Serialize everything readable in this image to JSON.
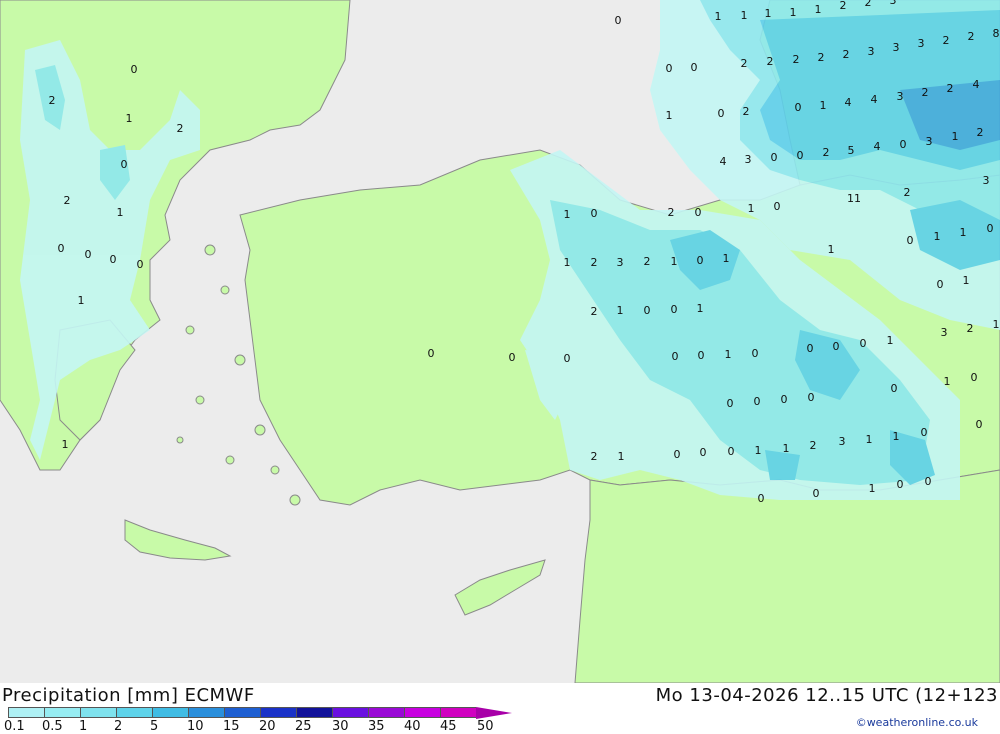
{
  "title": "Precipitation [mm] ECMWF",
  "datetime": "Mo 13-04-2026 12..15 UTC (12+123",
  "credit": "©weatheronline.co.uk",
  "legend": {
    "labels": [
      "0.1",
      "0.5",
      "1",
      "2",
      "5",
      "10",
      "15",
      "20",
      "25",
      "30",
      "35",
      "40",
      "45",
      "50"
    ],
    "colors": [
      "#aef0f4",
      "#96ecf2",
      "#7fe2ee",
      "#5ed3ea",
      "#40bce4",
      "#2a8fdc",
      "#1e5fd2",
      "#1a32c8",
      "#12129a",
      "#6a10e0",
      "#9a0ad6",
      "#c800e0",
      "#d000c0",
      "#a800a8"
    ]
  },
  "colors": {
    "sea": "#ececec",
    "land": "#c8faa8",
    "precip_light": "#c4f6f4",
    "precip_mid": "#8ee8ee",
    "precip_heavy": "#5ed0ea",
    "precip_max": "#40a8e0"
  },
  "map_values": [
    "0",
    "1",
    "1",
    "1",
    "1",
    "1",
    "2",
    "2",
    "3",
    "8",
    "0",
    "0",
    "2",
    "2",
    "2",
    "2",
    "2",
    "3",
    "3",
    "3",
    "2",
    "2",
    "0",
    "2",
    "1",
    "0",
    "1",
    "4",
    "4",
    "3",
    "2",
    "2",
    "4",
    "4",
    "3",
    "0",
    "0",
    "2",
    "5",
    "4",
    "0",
    "3",
    "1",
    "2",
    "2",
    "3",
    "11",
    "1",
    "0",
    "2",
    "0",
    "1",
    "0",
    "0",
    "1",
    "1",
    "0",
    "1",
    "1",
    "2",
    "3",
    "2",
    "1",
    "0",
    "1",
    "0",
    "1",
    "2",
    "1",
    "0",
    "0",
    "1",
    "3",
    "2",
    "1",
    "0",
    "0",
    "0",
    "1",
    "0",
    "0",
    "0",
    "0",
    "0",
    "1",
    "0",
    "1",
    "0",
    "0",
    "0",
    "0",
    "0",
    "0",
    "0",
    "0",
    "3",
    "1",
    "1",
    "2",
    "1",
    "0",
    "0",
    "0",
    "1",
    "1",
    "2",
    "1",
    "0",
    "0",
    "1",
    "0",
    "0",
    "2",
    "1",
    "2",
    "0",
    "2",
    "1",
    "0",
    "0",
    "0",
    "0",
    "1",
    "0",
    "0",
    "2"
  ]
}
